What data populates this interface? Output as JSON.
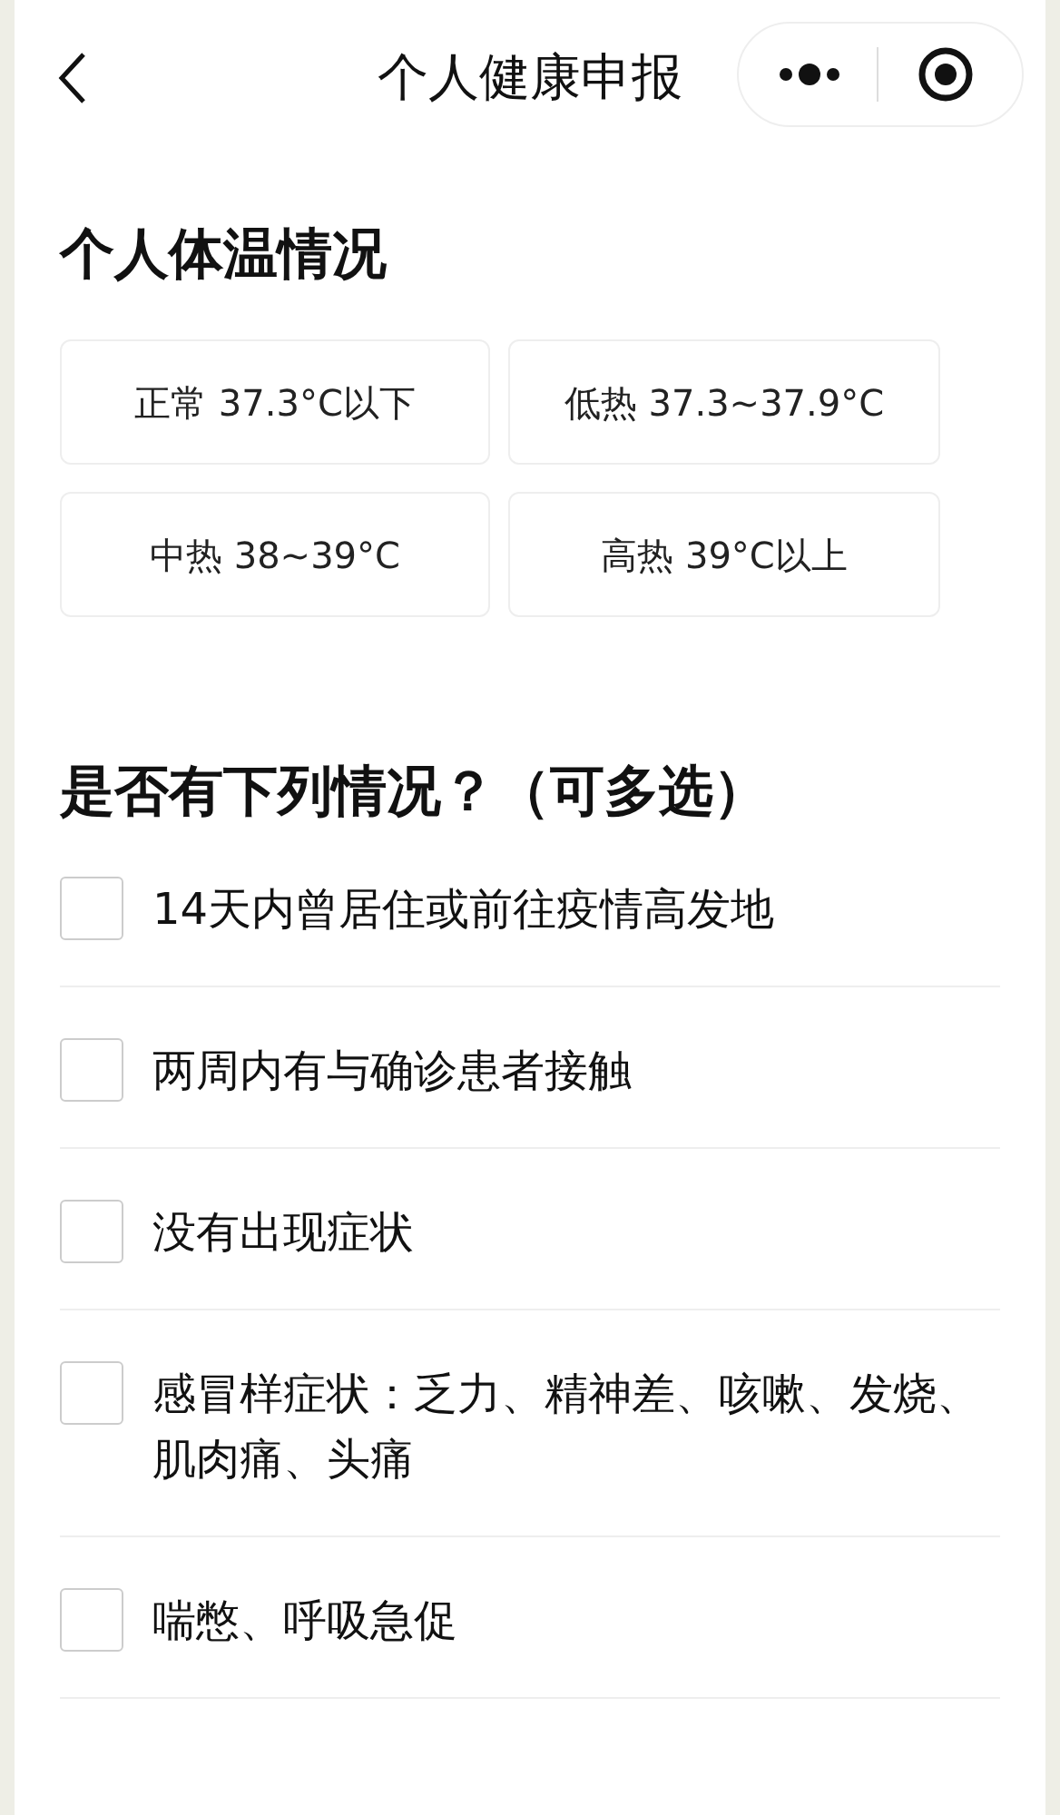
{
  "header": {
    "title": "个人健康申报"
  },
  "temperature": {
    "title": "个人体温情况",
    "options": [
      {
        "label": "正常 37.3°C以下",
        "selected": false
      },
      {
        "label": "低热 37.3~37.9°C",
        "selected": false
      },
      {
        "label": "中热 38~39°C",
        "selected": false
      },
      {
        "label": "高热 39°C以上",
        "selected": false
      }
    ]
  },
  "conditions": {
    "title": "是否有下列情况？（可多选）",
    "items": [
      {
        "label": "14天内曾居住或前往疫情高发地",
        "checked": false
      },
      {
        "label": "两周内有与确诊患者接触",
        "checked": false
      },
      {
        "label": "没有出现症状",
        "checked": false
      },
      {
        "label": "感冒样症状：乏力、精神差、咳嗽、发烧、肌肉痛、头痛",
        "checked": false
      },
      {
        "label": "喘憋、呼吸急促",
        "checked": false
      }
    ]
  }
}
